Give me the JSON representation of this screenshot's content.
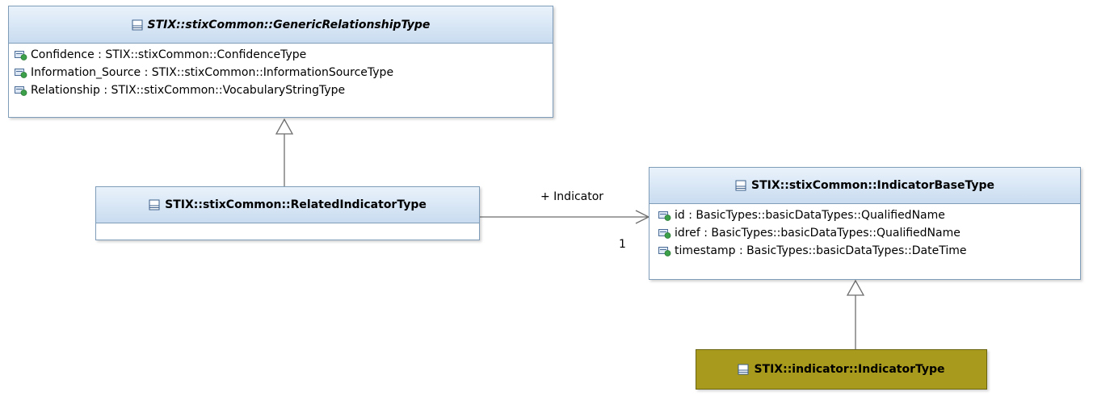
{
  "classes": {
    "generic_relationship": {
      "name": "STIX::stixCommon::GenericRelationshipType",
      "attributes": [
        "Confidence : STIX::stixCommon::ConfidenceType",
        "Information_Source : STIX::stixCommon::InformationSourceType",
        "Relationship : STIX::stixCommon::VocabularyStringType"
      ]
    },
    "related_indicator": {
      "name": "STIX::stixCommon::RelatedIndicatorType"
    },
    "indicator_base": {
      "name": "STIX::stixCommon::IndicatorBaseType",
      "attributes": [
        "id : BasicTypes::basicDataTypes::QualifiedName",
        "idref : BasicTypes::basicDataTypes::QualifiedName",
        "timestamp : BasicTypes::basicDataTypes::DateTime"
      ]
    },
    "indicator_type": {
      "name": "STIX::indicator::IndicatorType"
    }
  },
  "association": {
    "role": "+ Indicator",
    "multiplicity": "1"
  },
  "colors": {
    "class_header": "#c9dcf0",
    "class_border": "#7f9db9",
    "highlight_class": "#a89a1d",
    "attribute_icon": "#3ca04a"
  }
}
